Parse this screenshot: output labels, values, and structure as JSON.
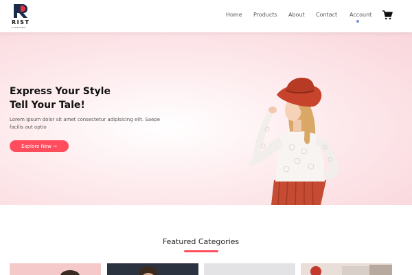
{
  "brand": {
    "name": "RIST",
    "tagline": "CLOTHING",
    "logo_icon": "r-logo-icon",
    "accent_color": "#ff4d5e"
  },
  "nav": {
    "items": [
      {
        "label": "Home"
      },
      {
        "label": "Products"
      },
      {
        "label": "About"
      },
      {
        "label": "Contact"
      },
      {
        "label": "Account"
      }
    ],
    "cart_icon": "cart-icon"
  },
  "hero": {
    "title_line1": "Express Your Style",
    "title_line2": "Tell Your Tale!",
    "description": "Lorem ipsum dolor sit amet consectetur adipisicing elit. Saepe facilis aut optio",
    "cta_label": "Explore Now →",
    "image": "woman-in-red-hat-photo"
  },
  "featured": {
    "title": "Featured Categories",
    "categories": [
      {
        "image": "category-photo-1"
      },
      {
        "image": "category-photo-2"
      },
      {
        "image": "category-photo-3"
      },
      {
        "image": "category-photo-4"
      }
    ]
  }
}
